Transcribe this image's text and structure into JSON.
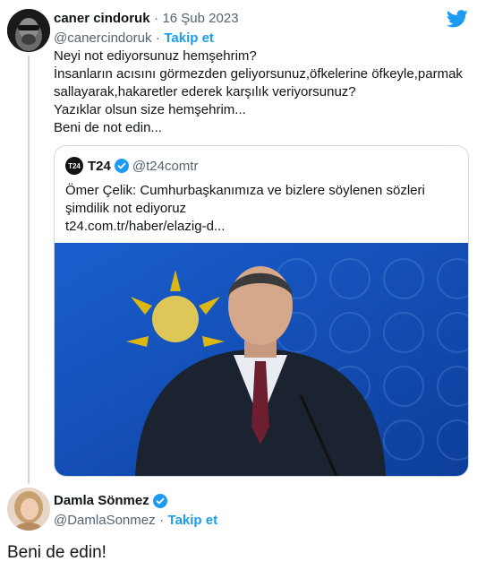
{
  "tweet": {
    "author_name": "caner cindoruk",
    "dot": "·",
    "date": "16 Şub 2023",
    "handle": "@canercindoruk",
    "follow_label": "Takip et",
    "lines": [
      "Neyi not ediyorsunuz hemşehrim?",
      "İnsanların acısını görmezden geliyorsunuz,öfkelerine öfkeyle,parmak",
      "sallayarak,hakaretler ederek karşılık veriyorsunuz?",
      "Yazıklar olsun size hemşehrim...",
      "Beni de not edin..."
    ]
  },
  "quote": {
    "logo_text": "T24",
    "name": "T24",
    "handle": "@t24comtr",
    "text_lines": [
      "Ömer Çelik: Cumhurbaşkanımıza ve bizlere söylenen sözleri",
      "şimdilik not ediyoruz"
    ],
    "link": "t24.com.tr/haber/elazig-d..."
  },
  "reply": {
    "author_name": "Damla Sönmez",
    "handle": "@DamlaSonmez",
    "dot": "·",
    "follow_label": "Takip et",
    "text": "Beni de edin!"
  },
  "icons": {
    "brand": "twitter-bird-icon",
    "verified": "verified-badge-icon"
  },
  "colors": {
    "accent": "#1d9bf0",
    "muted": "#536471",
    "border": "#cfd9de",
    "photo_bg": "#1f6fd6"
  }
}
